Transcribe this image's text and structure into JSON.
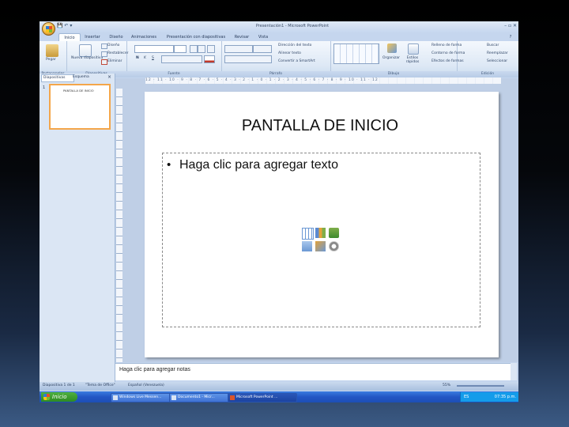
{
  "window": {
    "title": "Presentación1 - Microsoft PowerPoint",
    "controls": "– ▫ ✕"
  },
  "qat": {
    "icons": "💾 ↶ ▾"
  },
  "tabs": [
    "Inicio",
    "Insertar",
    "Diseño",
    "Animaciones",
    "Presentación con diapositivas",
    "Revisar",
    "Vista"
  ],
  "ribbon": {
    "groups": [
      "Portapapeles",
      "Diapositivas",
      "Fuente",
      "Párrafo",
      "Dibujo",
      "Edición"
    ],
    "paste_label": "Pegar",
    "new_slide_label": "Nueva diapositiva",
    "layout_label": "Diseño",
    "reset_label": "Restablecer",
    "delete_label": "Eliminar",
    "text_direction_label": "Dirección del texto",
    "align_text_label": "Alinear texto",
    "smartart_label": "Convertir a SmartArt",
    "arrange_label": "Organizar",
    "quick_styles_label": "Estilos rápidos",
    "shape_fill_label": "Relleno de forma",
    "shape_outline_label": "Contorno de forma",
    "shape_effects_label": "Efectos de formas",
    "find_label": "Buscar",
    "replace_label": "Reemplazar",
    "select_label": "Seleccionar",
    "bold": "N",
    "italic": "K",
    "underline": "S"
  },
  "panel": {
    "tab_slides": "Diapositivas",
    "tab_outline": "Esquema",
    "close": "×",
    "slide_number": "1"
  },
  "thumbnail": {
    "title": "PANTALLA DE INICIO"
  },
  "ruler": {
    "marks": "12 · 11 · 10 · 9 · 8 · 7 · 6 · 5 · 4 · 3 · 2 · 1 · 0 · 1 · 2 · 3 · 4 · 5 · 6 · 7 · 8 · 9 · 10 · 11 · 12"
  },
  "slide": {
    "title": "PANTALLA DE INICIO",
    "bullet": "•",
    "content_placeholder": "Haga clic para agregar texto"
  },
  "notes": {
    "placeholder": "Haga clic para agregar notas"
  },
  "status": {
    "slide": "Diapositiva 1 de 1",
    "theme": "\"Tema de Office\"",
    "language": "Español (Venezuela)",
    "zoom": "55%"
  },
  "taskbar": {
    "start": "Inicio",
    "buttons": [
      "Windows Live Messen...",
      "Documento1 - Micr...",
      "Microsoft PowerPoint ..."
    ],
    "language": "ES",
    "clock": "07:35 p.m."
  }
}
